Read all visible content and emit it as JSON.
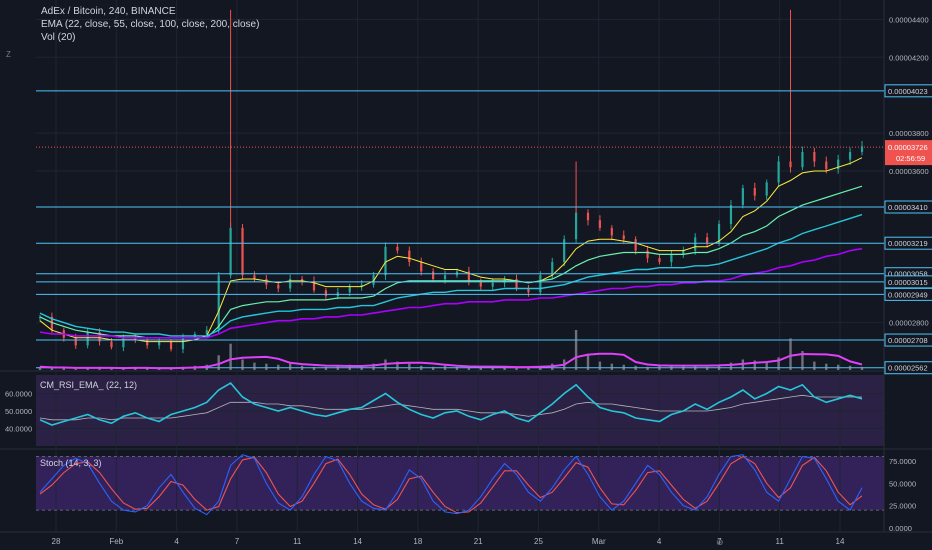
{
  "header": {
    "line1": "AdEx / Bitcoin, 240, BINANCE",
    "line2": "EMA (22, close, 55, close, 100, close, 200, close)",
    "line3": "Vol (20)"
  },
  "icons": {
    "left_glyph": "Z",
    "bottom_glyph": "⊕"
  },
  "colors": {
    "background": "#131722",
    "grid": "#1f2433",
    "up": "#26a69a",
    "down": "#ef5350",
    "hline": "#4fc3f7",
    "ema22": "#ffeb3b",
    "ema55": "#69f0ae",
    "ema100": "#26c6da",
    "ema200": "#aa00ff",
    "volume": "#9598a1",
    "vol_ma": "#e040fb",
    "rsi": "#26c6da",
    "rsi_signal": "#b2b5be",
    "rsi_band": "#3f2a63",
    "stoch_k": "#2962ff",
    "stoch_d": "#ef5350",
    "stoch_band": "#4a2a80"
  },
  "chart_data": [
    {
      "type": "candlestick",
      "title": "AdEx / Bitcoin, 240, BINANCE",
      "ylim": [
        2.55e-05,
        4.46e-05
      ],
      "y_ticks": [
        "0.00004400",
        "0.00004200",
        "0.00003800",
        "0.00003600",
        "0.00002800"
      ],
      "y_tick_values": [
        4.4e-05,
        4.2e-05,
        3.8e-05,
        3.6e-05,
        2.8e-05
      ],
      "x_ticks": [
        "28",
        "Feb",
        "4",
        "7",
        "11",
        "14",
        "18",
        "21",
        "25",
        "Mar",
        "4",
        "7",
        "11",
        "14"
      ],
      "horizontal_levels": [
        {
          "label": "0.00004023",
          "value": 4.023e-05
        },
        {
          "label": "0.00003410",
          "value": 3.41e-05
        },
        {
          "label": "0.00003219",
          "value": 3.219e-05
        },
        {
          "label": "0.00003058",
          "value": 3.058e-05
        },
        {
          "label": "0.00003015",
          "value": 3.015e-05
        },
        {
          "label": "0.00002949",
          "value": 2.949e-05
        },
        {
          "label": "0.00002708",
          "value": 2.708e-05
        },
        {
          "label": "0.00002562",
          "value": 2.562e-05
        }
      ],
      "last_price": {
        "label": "0.00003726",
        "value": 3.726e-05,
        "countdown": "02:56:59"
      },
      "close_path": [
        2.83e-05,
        2.76e-05,
        2.72e-05,
        2.68e-05,
        2.75e-05,
        2.7e-05,
        2.67e-05,
        2.72e-05,
        2.71e-05,
        2.68e-05,
        2.7e-05,
        2.66e-05,
        2.72e-05,
        2.74e-05,
        2.76e-05,
        3.05e-05,
        3.3e-05,
        3.05e-05,
        3.03e-05,
        3e-05,
        2.98e-05,
        3.03e-05,
        3.02e-05,
        2.97e-05,
        2.94e-05,
        2.96e-05,
        2.99e-05,
        3e-05,
        3.05e-05,
        3.2e-05,
        3.18e-05,
        3.12e-05,
        3.07e-05,
        3.03e-05,
        3.05e-05,
        3.07e-05,
        3.02e-05,
        2.99e-05,
        3.01e-05,
        3.03e-05,
        2.98e-05,
        2.96e-05,
        3.05e-05,
        3.12e-05,
        3.24e-05,
        3.38e-05,
        3.34e-05,
        3.3e-05,
        3.26e-05,
        3.24e-05,
        3.18e-05,
        3.14e-05,
        3.12e-05,
        3.16e-05,
        3.18e-05,
        3.25e-05,
        3.22e-05,
        3.32e-05,
        3.42e-05,
        3.51e-05,
        3.47e-05,
        3.54e-05,
        3.65e-05,
        3.62e-05,
        3.7e-05,
        3.65e-05,
        3.61e-05,
        3.66e-05,
        3.7e-05,
        3.73e-05
      ],
      "ema": [
        {
          "name": "EMA 22",
          "values": [
            2.81e-05,
            2.76e-05,
            2.74e-05,
            2.72e-05,
            2.72e-05,
            2.72e-05,
            2.71e-05,
            2.71e-05,
            2.71e-05,
            2.7e-05,
            2.7e-05,
            2.7e-05,
            2.7e-05,
            2.71e-05,
            2.73e-05,
            2.86e-05,
            3.02e-05,
            3.03e-05,
            3.03e-05,
            3.02e-05,
            3.01e-05,
            3.02e-05,
            3.02e-05,
            3.01e-05,
            2.99e-05,
            2.99e-05,
            2.99e-05,
            2.99e-05,
            3.02e-05,
            3.12e-05,
            3.15e-05,
            3.14e-05,
            3.12e-05,
            3.1e-05,
            3.08e-05,
            3.08e-05,
            3.06e-05,
            3.04e-05,
            3.03e-05,
            3.03e-05,
            3.02e-05,
            3.01e-05,
            3.02e-05,
            3.05e-05,
            3.11e-05,
            3.19e-05,
            3.23e-05,
            3.24e-05,
            3.24e-05,
            3.23e-05,
            3.22e-05,
            3.2e-05,
            3.18e-05,
            3.18e-05,
            3.18e-05,
            3.2e-05,
            3.2e-05,
            3.23e-05,
            3.28e-05,
            3.36e-05,
            3.39e-05,
            3.44e-05,
            3.52e-05,
            3.55e-05,
            3.59e-05,
            3.6e-05,
            3.6e-05,
            3.62e-05,
            3.64e-05,
            3.67e-05
          ]
        },
        {
          "name": "EMA 55",
          "values": [
            2.83e-05,
            2.8e-05,
            2.78e-05,
            2.76e-05,
            2.75e-05,
            2.74e-05,
            2.73e-05,
            2.73e-05,
            2.73e-05,
            2.72e-05,
            2.72e-05,
            2.72e-05,
            2.72e-05,
            2.72e-05,
            2.72e-05,
            2.78e-05,
            2.87e-05,
            2.89e-05,
            2.9e-05,
            2.91e-05,
            2.91e-05,
            2.92e-05,
            2.92e-05,
            2.92e-05,
            2.92e-05,
            2.93e-05,
            2.93e-05,
            2.93e-05,
            2.94e-05,
            2.98e-05,
            3.01e-05,
            3.02e-05,
            3.02e-05,
            3.02e-05,
            3.02e-05,
            3.02e-05,
            3.02e-05,
            3.02e-05,
            3.02e-05,
            3.02e-05,
            3.02e-05,
            3.01e-05,
            3.02e-05,
            3.03e-05,
            3.06e-05,
            3.1e-05,
            3.13e-05,
            3.15e-05,
            3.16e-05,
            3.17e-05,
            3.17e-05,
            3.17e-05,
            3.16e-05,
            3.16e-05,
            3.16e-05,
            3.17e-05,
            3.17e-05,
            3.19e-05,
            3.22e-05,
            3.26e-05,
            3.28e-05,
            3.31e-05,
            3.36e-05,
            3.39e-05,
            3.42e-05,
            3.44e-05,
            3.46e-05,
            3.48e-05,
            3.5e-05,
            3.52e-05
          ]
        },
        {
          "name": "EMA 100",
          "values": [
            2.85e-05,
            2.82e-05,
            2.8e-05,
            2.78e-05,
            2.77e-05,
            2.76e-05,
            2.75e-05,
            2.75e-05,
            2.74e-05,
            2.74e-05,
            2.74e-05,
            2.73e-05,
            2.73e-05,
            2.73e-05,
            2.73e-05,
            2.76e-05,
            2.81e-05,
            2.83e-05,
            2.84e-05,
            2.85e-05,
            2.86e-05,
            2.86e-05,
            2.87e-05,
            2.87e-05,
            2.87e-05,
            2.88e-05,
            2.88e-05,
            2.89e-05,
            2.89e-05,
            2.91e-05,
            2.93e-05,
            2.94e-05,
            2.95e-05,
            2.96e-05,
            2.96e-05,
            2.97e-05,
            2.97e-05,
            2.97e-05,
            2.97e-05,
            2.98e-05,
            2.98e-05,
            2.98e-05,
            2.98e-05,
            2.99e-05,
            3e-05,
            3.02e-05,
            3.04e-05,
            3.05e-05,
            3.06e-05,
            3.07e-05,
            3.08e-05,
            3.08e-05,
            3.09e-05,
            3.09e-05,
            3.09e-05,
            3.1e-05,
            3.1e-05,
            3.11e-05,
            3.13e-05,
            3.15e-05,
            3.17e-05,
            3.19e-05,
            3.22e-05,
            3.24e-05,
            3.27e-05,
            3.29e-05,
            3.31e-05,
            3.33e-05,
            3.35e-05,
            3.37e-05
          ]
        },
        {
          "name": "EMA 200",
          "values": [
            2.75e-05,
            2.74e-05,
            2.74e-05,
            2.73e-05,
            2.73e-05,
            2.73e-05,
            2.73e-05,
            2.72e-05,
            2.72e-05,
            2.72e-05,
            2.72e-05,
            2.72e-05,
            2.72e-05,
            2.72e-05,
            2.72e-05,
            2.74e-05,
            2.77e-05,
            2.78e-05,
            2.79e-05,
            2.8e-05,
            2.81e-05,
            2.81e-05,
            2.82e-05,
            2.82e-05,
            2.83e-05,
            2.83e-05,
            2.84e-05,
            2.84e-05,
            2.85e-05,
            2.86e-05,
            2.87e-05,
            2.88e-05,
            2.88e-05,
            2.89e-05,
            2.9e-05,
            2.9e-05,
            2.91e-05,
            2.91e-05,
            2.91e-05,
            2.92e-05,
            2.92e-05,
            2.92e-05,
            2.93e-05,
            2.93e-05,
            2.94e-05,
            2.95e-05,
            2.96e-05,
            2.97e-05,
            2.98e-05,
            2.98e-05,
            2.99e-05,
            2.99e-05,
            3e-05,
            3e-05,
            3.01e-05,
            3.01e-05,
            3.02e-05,
            3.02e-05,
            3.03e-05,
            3.05e-05,
            3.06e-05,
            3.07e-05,
            3.09e-05,
            3.1e-05,
            3.12e-05,
            3.13e-05,
            3.15e-05,
            3.16e-05,
            3.18e-05,
            3.19e-05
          ]
        }
      ],
      "spikes": [
        {
          "index": 16,
          "high": 4.45e-05
        },
        {
          "index": 45,
          "high": 3.65e-05
        },
        {
          "index": 63,
          "high": 4.45e-05
        }
      ]
    },
    {
      "type": "bar",
      "title": "Vol (20)",
      "volume_pattern": [
        3,
        2,
        2,
        1,
        2,
        3,
        2,
        1,
        2,
        2,
        1,
        2,
        3,
        4,
        5,
        14,
        25,
        10,
        7,
        6,
        5,
        6,
        4,
        3,
        3,
        4,
        5,
        4,
        6,
        10,
        8,
        6,
        4,
        3,
        4,
        3,
        3,
        3,
        3,
        3,
        2,
        3,
        4,
        6,
        10,
        38,
        15,
        8,
        6,
        5,
        4,
        3,
        4,
        5,
        5,
        4,
        3,
        5,
        7,
        10,
        9,
        7,
        12,
        30,
        18,
        8,
        6,
        5,
        4,
        3
      ]
    },
    {
      "type": "line",
      "title": "CM_RSI_EMA_ (22, 12)",
      "ylim": [
        30,
        70
      ],
      "y_ticks": [
        "60.0000",
        "50.0000",
        "40.0000"
      ],
      "y_tick_values": [
        60,
        50,
        40
      ],
      "rsi": [
        45,
        42,
        44,
        46,
        48,
        45,
        43,
        47,
        49,
        46,
        44,
        48,
        50,
        52,
        55,
        62,
        66,
        58,
        54,
        52,
        50,
        52,
        50,
        48,
        47,
        49,
        51,
        52,
        56,
        60,
        55,
        51,
        48,
        46,
        49,
        50,
        47,
        45,
        48,
        50,
        46,
        44,
        49,
        54,
        60,
        65,
        58,
        52,
        50,
        49,
        46,
        45,
        44,
        48,
        50,
        54,
        51,
        55,
        58,
        62,
        57,
        60,
        64,
        62,
        65,
        58,
        55,
        57,
        59,
        57
      ],
      "signal": [
        46,
        45,
        45,
        45,
        46,
        46,
        45,
        46,
        46,
        46,
        46,
        46,
        47,
        48,
        49,
        52,
        55,
        55,
        55,
        54,
        54,
        53,
        53,
        52,
        51,
        51,
        51,
        51,
        52,
        53,
        54,
        53,
        52,
        51,
        51,
        51,
        50,
        49,
        49,
        49,
        48,
        47,
        48,
        49,
        51,
        54,
        55,
        54,
        54,
        53,
        52,
        51,
        50,
        50,
        50,
        50,
        50,
        51,
        52,
        54,
        55,
        56,
        57,
        58,
        59,
        58,
        58,
        58,
        58,
        58
      ]
    },
    {
      "type": "line",
      "title": "Stoch (14, 3, 3)",
      "ylim": [
        0,
        85
      ],
      "y_ticks": [
        "75.0000",
        "50.0000",
        "25.0000",
        "0.0000"
      ],
      "y_tick_values": [
        75,
        50,
        25,
        0
      ],
      "k": [
        40,
        55,
        70,
        78,
        72,
        50,
        30,
        20,
        18,
        25,
        45,
        60,
        40,
        22,
        15,
        30,
        70,
        82,
        78,
        50,
        28,
        20,
        35,
        60,
        80,
        75,
        50,
        30,
        22,
        20,
        40,
        65,
        55,
        30,
        18,
        16,
        20,
        35,
        55,
        72,
        60,
        40,
        30,
        45,
        65,
        80,
        60,
        35,
        20,
        30,
        50,
        70,
        60,
        40,
        25,
        20,
        35,
        60,
        80,
        82,
        65,
        40,
        30,
        55,
        80,
        78,
        55,
        30,
        20,
        45
      ],
      "d": [
        38,
        48,
        62,
        72,
        74,
        62,
        44,
        28,
        21,
        22,
        35,
        52,
        48,
        32,
        20,
        24,
        55,
        76,
        79,
        62,
        38,
        24,
        30,
        50,
        72,
        77,
        60,
        38,
        26,
        21,
        32,
        55,
        58,
        40,
        24,
        17,
        18,
        28,
        46,
        64,
        64,
        48,
        34,
        40,
        56,
        73,
        68,
        45,
        27,
        26,
        42,
        62,
        64,
        48,
        32,
        22,
        30,
        50,
        72,
        80,
        72,
        50,
        34,
        45,
        70,
        79,
        64,
        40,
        26,
        36
      ]
    }
  ]
}
